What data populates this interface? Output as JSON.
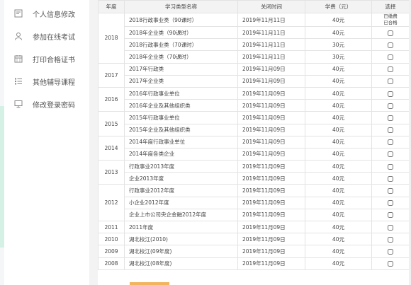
{
  "sidebar": {
    "items": [
      {
        "label": "个人信息修改",
        "icon": "profile-edit-icon"
      },
      {
        "label": "参加在线考试",
        "icon": "user-icon"
      },
      {
        "label": "打印合格证书",
        "icon": "calendar-icon"
      },
      {
        "label": "其他辅导课程",
        "icon": "list-icon"
      },
      {
        "label": "修改登录密码",
        "icon": "monitor-icon"
      }
    ]
  },
  "table": {
    "headers": [
      "年度",
      "学习类型名称",
      "关闭时间",
      "学费（元）",
      "选择"
    ],
    "groups": [
      {
        "year": "2018",
        "rows": [
          {
            "name": "2018行政事业类（90课时）",
            "close": "2019年11月11日",
            "fee": "40元",
            "status": [
              "已缴费",
              "已合格"
            ]
          },
          {
            "name": "2018年企业类（90课时）",
            "close": "2019年11月11日",
            "fee": "40元"
          },
          {
            "name": "2018行政事业类（70课时）",
            "close": "2019年11月11日",
            "fee": "30元"
          },
          {
            "name": "2018年企业类（70课时）",
            "close": "2019年11月11日",
            "fee": "30元"
          }
        ]
      },
      {
        "year": "2017",
        "rows": [
          {
            "name": "2017年行政类",
            "close": "2019年11月09日",
            "fee": "40元"
          },
          {
            "name": "2017年企业类",
            "close": "2019年11月09日",
            "fee": "40元"
          }
        ]
      },
      {
        "year": "2016",
        "rows": [
          {
            "name": "2016年行政事业单位",
            "close": "2019年11月09日",
            "fee": "40元"
          },
          {
            "name": "2016年企业及其他组织类",
            "close": "2019年11月09日",
            "fee": "40元"
          }
        ]
      },
      {
        "year": "2015",
        "rows": [
          {
            "name": "2015年行政事业单位",
            "close": "2019年11月09日",
            "fee": "40元"
          },
          {
            "name": "2015年企业及其他组织类",
            "close": "2019年11月09日",
            "fee": "40元"
          }
        ]
      },
      {
        "year": "2014",
        "rows": [
          {
            "name": "2014年度行政事业单位",
            "close": "2019年11月09日",
            "fee": "40元"
          },
          {
            "name": "2014年度各类企业",
            "close": "2019年11月09日",
            "fee": "40元"
          }
        ]
      },
      {
        "year": "2013",
        "rows": [
          {
            "name": "行政事业2013年度",
            "close": "2019年11月09日",
            "fee": "40元"
          },
          {
            "name": "企业2013年度",
            "close": "2019年11月09日",
            "fee": "40元"
          }
        ]
      },
      {
        "year": "2012",
        "rows": [
          {
            "name": "行政事业2012年度",
            "close": "2019年11月09日",
            "fee": "40元"
          },
          {
            "name": "小企业2012年度",
            "close": "2019年11月09日",
            "fee": "40元"
          },
          {
            "name": "企业上市公司央企金融2012年度",
            "close": "2019年11月09日",
            "fee": "40元"
          }
        ]
      },
      {
        "year": "2011",
        "rows": [
          {
            "name": "2011年度",
            "close": "2019年11月09日",
            "fee": "40元"
          }
        ]
      },
      {
        "year": "2010",
        "rows": [
          {
            "name": "湖北校江(2010)",
            "close": "2019年11月09日",
            "fee": "40元"
          }
        ]
      },
      {
        "year": "2009",
        "rows": [
          {
            "name": "湖北校江(09年度)",
            "close": "2019年11月09日",
            "fee": "40元"
          }
        ]
      },
      {
        "year": "2008",
        "rows": [
          {
            "name": "湖北校江(08年度)",
            "close": "2019年11月09日",
            "fee": "40元"
          }
        ]
      }
    ]
  }
}
